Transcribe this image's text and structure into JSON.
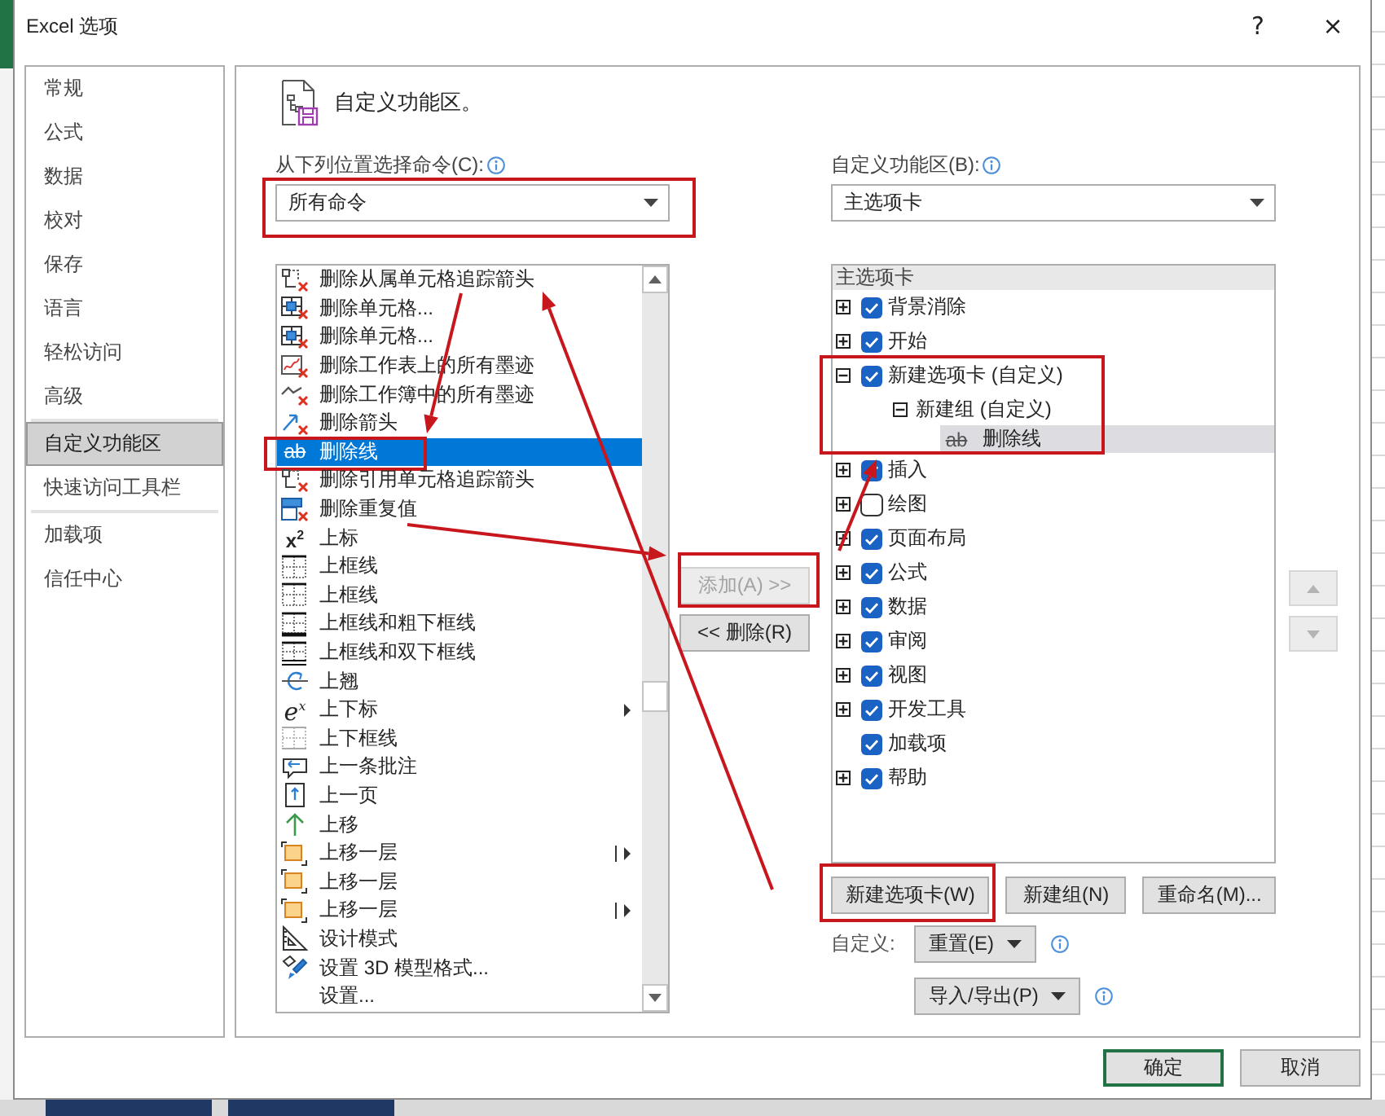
{
  "window": {
    "title": "Excel 选项",
    "help": "?",
    "close": "×"
  },
  "sidebar": {
    "sections": [
      {
        "items": [
          {
            "label": "常规",
            "selected": false
          },
          {
            "label": "公式",
            "selected": false
          },
          {
            "label": "数据",
            "selected": false
          },
          {
            "label": "校对",
            "selected": false
          },
          {
            "label": "保存",
            "selected": false
          },
          {
            "label": "语言",
            "selected": false
          },
          {
            "label": "轻松访问",
            "selected": false
          },
          {
            "label": "高级",
            "selected": false
          }
        ]
      },
      {
        "items": [
          {
            "label": "自定义功能区",
            "selected": true
          },
          {
            "label": "快速访问工具栏",
            "selected": false
          }
        ]
      },
      {
        "items": [
          {
            "label": "加载项",
            "selected": false
          },
          {
            "label": "信任中心",
            "selected": false
          }
        ]
      }
    ]
  },
  "page": {
    "title": "自定义功能区。",
    "source": {
      "label": "从下列位置选择命令(C):",
      "value": "所有命令",
      "highlighted": true
    },
    "target": {
      "label": "自定义功能区(B):",
      "value": "主选项卡",
      "highlighted": false
    },
    "commands": [
      {
        "label": "删除从属单元格追踪箭头",
        "kind": "tracedelete",
        "submenu": false,
        "selected": false,
        "highlighted": false
      },
      {
        "label": "删除单元格...",
        "kind": "celldelete",
        "submenu": false,
        "selected": false,
        "highlighted": false
      },
      {
        "label": "删除单元格...",
        "kind": "celldelete",
        "submenu": false,
        "selected": false,
        "highlighted": false
      },
      {
        "label": "删除工作表上的所有墨迹",
        "kind": "inkdelete",
        "submenu": false,
        "selected": false,
        "highlighted": false
      },
      {
        "label": "删除工作簿中的所有墨迹",
        "kind": "strokedelete",
        "submenu": false,
        "selected": false,
        "highlighted": false
      },
      {
        "label": "删除箭头",
        "kind": "arrowdelete",
        "submenu": false,
        "selected": false,
        "highlighted": false
      },
      {
        "label": "删除线",
        "kind": "strike",
        "glyph": "ab",
        "submenu": false,
        "selected": true,
        "highlighted": true
      },
      {
        "label": "删除引用单元格追踪箭头",
        "kind": "tracedelete",
        "submenu": false,
        "selected": false,
        "highlighted": false
      },
      {
        "label": "删除重复值",
        "kind": "duplicatedelete",
        "submenu": false,
        "selected": false,
        "highlighted": false
      },
      {
        "label": "上标",
        "kind": "superscript",
        "glyph": "x$^{2}$",
        "submenu": false,
        "selected": false,
        "highlighted": false
      },
      {
        "label": "上框线",
        "kind": "border",
        "submenu": false,
        "selected": false,
        "highlighted": false
      },
      {
        "label": "上框线",
        "kind": "border",
        "submenu": false,
        "selected": false,
        "highlighted": false
      },
      {
        "label": "上框线和粗下框线",
        "kind": "thickborder",
        "submenu": false,
        "selected": false,
        "highlighted": false
      },
      {
        "label": "上框线和双下框线",
        "kind": "doubleborder",
        "submenu": false,
        "selected": false,
        "highlighted": false
      },
      {
        "label": "上翘",
        "kind": "warp",
        "submenu": false,
        "selected": false,
        "highlighted": false
      },
      {
        "label": "上下标",
        "kind": "exponent",
        "glyph": "e$^{x}$",
        "submenu": true,
        "split": false,
        "selected": false,
        "highlighted": false
      },
      {
        "label": "上下框线",
        "kind": "lightborder",
        "submenu": false,
        "selected": false,
        "highlighted": false
      },
      {
        "label": "上一条批注",
        "kind": "comment",
        "submenu": false,
        "selected": false,
        "highlighted": false
      },
      {
        "label": "上一页",
        "kind": "pageup",
        "submenu": false,
        "selected": false,
        "highlighted": false
      },
      {
        "label": "上移",
        "kind": "up",
        "submenu": false,
        "selected": false,
        "highlighted": false
      },
      {
        "label": "上移一层",
        "kind": "layer",
        "submenu": true,
        "split": true,
        "selected": false,
        "highlighted": false
      },
      {
        "label": "上移一层",
        "kind": "layer",
        "submenu": false,
        "selected": false,
        "highlighted": false
      },
      {
        "label": "上移一层",
        "kind": "layer",
        "submenu": true,
        "split": true,
        "selected": false,
        "highlighted": false
      },
      {
        "label": "设计模式",
        "kind": "design",
        "submenu": false,
        "selected": false,
        "highlighted": false
      },
      {
        "label": "设置 3D 模型格式...",
        "kind": "model",
        "submenu": false,
        "selected": false,
        "highlighted": false
      },
      {
        "label": "设置...",
        "kind": "plain",
        "submenu": false,
        "selected": false,
        "highlighted": false
      }
    ],
    "add_button": {
      "label": "添加(A) >>",
      "disabled": true,
      "highlighted": true
    },
    "remove_button": {
      "label": "<< 删除(R)",
      "disabled": false,
      "highlighted": false
    },
    "tree": {
      "header": "主选项卡",
      "items": [
        {
          "label": "背景消除",
          "kind": "tab",
          "expandable": true,
          "expanded": false,
          "checked": true,
          "selected": false,
          "highlighted": false
        },
        {
          "label": "开始",
          "kind": "tab",
          "expandable": true,
          "expanded": false,
          "checked": true,
          "selected": false,
          "highlighted": false
        },
        {
          "label": "新建选项卡 (自定义)",
          "kind": "tab",
          "expandable": true,
          "expanded": true,
          "checked": true,
          "selected": false,
          "highlighted": true,
          "children": [
            {
              "label": "新建组 (自定义)",
              "kind": "group",
              "expandable": true,
              "expanded": true,
              "selected": false,
              "children": [
                {
                  "label": "删除线",
                  "kind": "strike",
                  "glyph": "ab",
                  "selected": true
                }
              ]
            }
          ]
        },
        {
          "label": "插入",
          "kind": "tab",
          "expandable": true,
          "expanded": false,
          "checked": true,
          "selected": false,
          "highlighted": false
        },
        {
          "label": "绘图",
          "kind": "tab",
          "expandable": true,
          "expanded": false,
          "checked": false,
          "selected": false,
          "highlighted": false
        },
        {
          "label": "页面布局",
          "kind": "tab",
          "expandable": true,
          "expanded": false,
          "checked": true,
          "selected": false,
          "highlighted": false
        },
        {
          "label": "公式",
          "kind": "tab",
          "expandable": true,
          "expanded": false,
          "checked": true,
          "selected": false,
          "highlighted": false
        },
        {
          "label": "数据",
          "kind": "tab",
          "expandable": true,
          "expanded": false,
          "checked": true,
          "selected": false,
          "highlighted": false
        },
        {
          "label": "审阅",
          "kind": "tab",
          "expandable": true,
          "expanded": false,
          "checked": true,
          "selected": false,
          "highlighted": false
        },
        {
          "label": "视图",
          "kind": "tab",
          "expandable": true,
          "expanded": false,
          "checked": true,
          "selected": false,
          "highlighted": false
        },
        {
          "label": "开发工具",
          "kind": "tab",
          "expandable": true,
          "expanded": false,
          "checked": true,
          "selected": false,
          "highlighted": false
        },
        {
          "label": "加载项",
          "kind": "tab",
          "expandable": false,
          "checked": true,
          "selected": false,
          "highlighted": false
        },
        {
          "label": "帮助",
          "kind": "tab",
          "expandable": true,
          "expanded": false,
          "checked": true,
          "selected": false,
          "highlighted": false
        }
      ]
    },
    "move_up": {
      "disabled": true
    },
    "move_down": {
      "disabled": true
    },
    "tree_buttons": [
      {
        "label": "新建选项卡(W)",
        "highlighted": true
      },
      {
        "label": "新建组(N)",
        "highlighted": false
      },
      {
        "label": "重命名(M)...",
        "highlighted": false
      }
    ],
    "customize": {
      "label": "自定义:",
      "reset": "重置(E)",
      "import_export": "导入/导出(P)"
    }
  },
  "footer": {
    "buttons": [
      {
        "label": "确定",
        "default": true
      },
      {
        "label": "取消",
        "default": false
      }
    ]
  }
}
